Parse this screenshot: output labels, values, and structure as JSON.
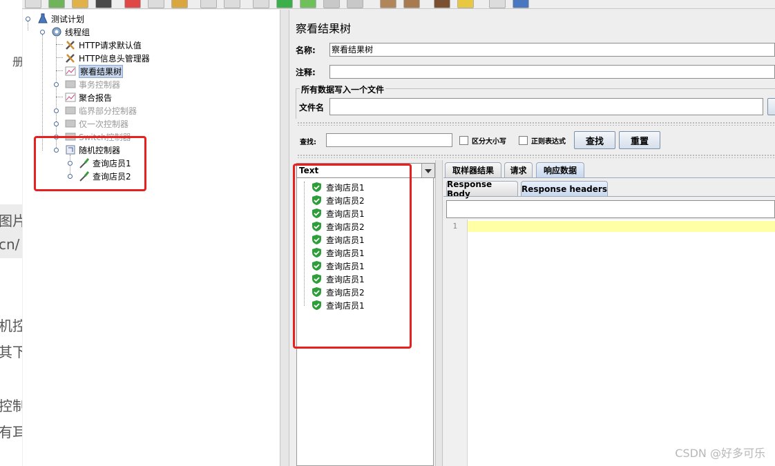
{
  "background_article": {
    "lines": [
      "册",
      "图片",
      "cn/",
      "机控",
      "其下",
      "控制",
      "有耳"
    ]
  },
  "tree": {
    "items": [
      {
        "label": "测试计划",
        "icon": "test-plan-icon",
        "disabled": false
      },
      {
        "label": "线程组",
        "icon": "gear-icon",
        "disabled": false
      },
      {
        "label": "HTTP请求默认值",
        "icon": "tools-icon",
        "disabled": false
      },
      {
        "label": "HTTP信息头管理器",
        "icon": "tools-icon",
        "disabled": false
      },
      {
        "label": "察看结果树",
        "icon": "graph-icon",
        "disabled": false,
        "selected": true
      },
      {
        "label": "事务控制器",
        "icon": "controller-icon",
        "disabled": true
      },
      {
        "label": "聚合报告",
        "icon": "graph-icon",
        "disabled": false
      },
      {
        "label": "临界部分控制器",
        "icon": "controller-icon",
        "disabled": true
      },
      {
        "label": "仅一次控制器",
        "icon": "controller-icon",
        "disabled": true
      },
      {
        "label": "Switch控制器",
        "icon": "controller-icon",
        "disabled": true
      },
      {
        "label": "随机控制器",
        "icon": "random-controller-icon",
        "disabled": false
      },
      {
        "label": "查询店员1",
        "icon": "sampler-icon",
        "disabled": false
      },
      {
        "label": "查询店员2",
        "icon": "sampler-icon",
        "disabled": false
      }
    ]
  },
  "panel": {
    "title": "察看结果树",
    "name_label": "名称:",
    "name_value": "察看结果树",
    "comment_label": "注释:",
    "comment_value": "",
    "group_title": "所有数据写入一个文件",
    "file_label": "文件名",
    "file_value": ""
  },
  "search": {
    "label": "查找:",
    "value": "",
    "case_label": "区分大小写",
    "regex_label": "正则表达式",
    "find_button": "查找",
    "reset_button": "重置"
  },
  "results": {
    "renderer": "Text",
    "items": [
      "查询店员1",
      "查询店员2",
      "查询店员1",
      "查询店员2",
      "查询店员1",
      "查询店员1",
      "查询店员1",
      "查询店员1",
      "查询店员2",
      "查询店员1"
    ]
  },
  "tabs": {
    "main": [
      "取样器结果",
      "请求",
      "响应数据"
    ],
    "active_main": "响应数据",
    "sub": [
      "Response Body",
      "Response headers"
    ],
    "active_sub": "Response headers"
  },
  "editor": {
    "line_number": "1"
  },
  "watermark": "CSDN @好多可乐",
  "colors": {
    "annotation": "#e81f1f",
    "highlight_line": "#ffffa6",
    "success_icon": "#2e9e3a"
  }
}
